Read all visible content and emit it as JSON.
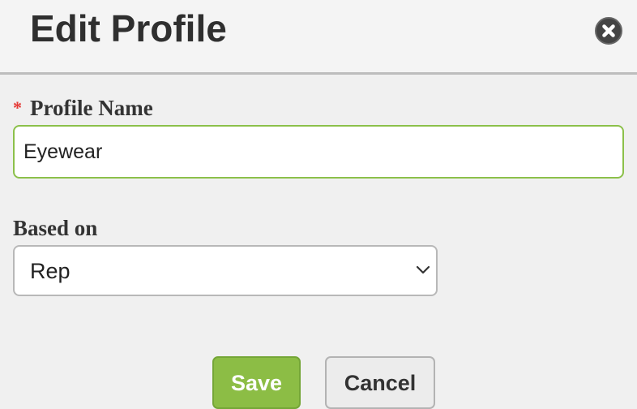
{
  "dialog": {
    "title": "Edit Profile",
    "close_icon": "close-circle-icon"
  },
  "form": {
    "profile_name": {
      "required_marker": "*",
      "label": "Profile Name",
      "value": "Eyewear"
    },
    "based_on": {
      "label": "Based on",
      "selected": "Rep",
      "dropdown_icon": "chevron-down-icon"
    }
  },
  "actions": {
    "save_label": "Save",
    "cancel_label": "Cancel"
  },
  "colors": {
    "accent_green": "#8cbd45",
    "input_focus_border": "#8cc04a",
    "required_red": "#e53935"
  }
}
